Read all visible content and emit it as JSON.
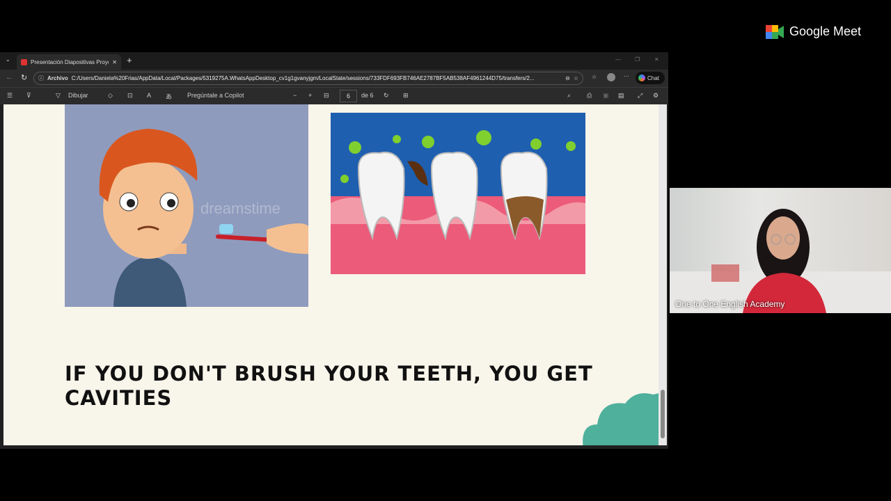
{
  "browser": {
    "tab_title": "Presentación Diapositivas Proyecto",
    "address_prefix": "Archivo",
    "url": "C:/Users/Daniela%20Frias/AppData/Local/Packages/5319275A.WhatsAppDesktop_cv1g1gvanyjgm/LocalState/sessions/733FDF693FB746AE2787BF5AB538AF4961244D75/transfers/2...",
    "chat_label": "Chat"
  },
  "pdf_toolbar": {
    "draw_label": "Dibujar",
    "copilot_label": "Pregúntale a Copilot",
    "page_current": "6",
    "page_total": "de 6"
  },
  "slide": {
    "caption": "IF YOU DON'T BRUSH YOUR TEETH, YOU GET CAVITIES",
    "watermark": "dreamstime"
  },
  "meet": {
    "brand": "Google Meet",
    "participant_name": "One to One English Academy"
  }
}
